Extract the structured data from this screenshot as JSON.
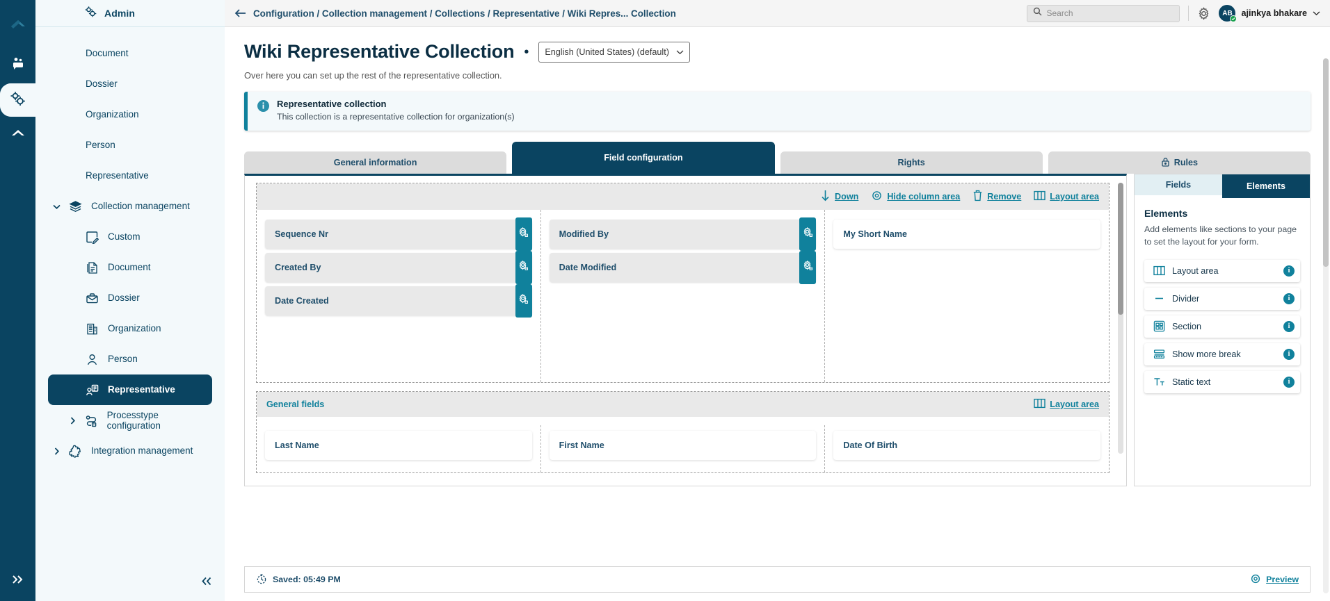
{
  "rail": {
    "logo_icon": "cloud-logo-icon",
    "items": [
      {
        "icon": "people-group-icon",
        "active": false
      },
      {
        "icon": "gears-config-icon",
        "active": true
      },
      {
        "icon": "cloud-arrow-icon",
        "active": false
      }
    ],
    "expand_icon": "chevron-double-right-icon"
  },
  "sidebar": {
    "header": {
      "icon": "gears-icon",
      "title": "Admin"
    },
    "items": [
      {
        "label": "Document",
        "level": "plain",
        "icon": null,
        "chevron": null,
        "active": false
      },
      {
        "label": "Dossier",
        "level": "plain",
        "icon": null,
        "chevron": null,
        "active": false
      },
      {
        "label": "Organization",
        "level": "plain",
        "icon": null,
        "chevron": null,
        "active": false
      },
      {
        "label": "Person",
        "level": "plain",
        "icon": null,
        "chevron": null,
        "active": false
      },
      {
        "label": "Representative",
        "level": "plain",
        "icon": null,
        "chevron": null,
        "active": false
      },
      {
        "label": "Collection management",
        "level": "lvl0",
        "icon": "layers-icon",
        "chevron": "down",
        "active": false
      },
      {
        "label": "Custom",
        "level": "lvl1",
        "icon": "note-edit-icon",
        "chevron": null,
        "active": false
      },
      {
        "label": "Document",
        "level": "lvl1",
        "icon": "document-icon",
        "chevron": null,
        "active": false
      },
      {
        "label": "Dossier",
        "level": "lvl1",
        "icon": "briefcase-icon",
        "chevron": null,
        "active": false
      },
      {
        "label": "Organization",
        "level": "lvl1",
        "icon": "building-icon",
        "chevron": null,
        "active": false
      },
      {
        "label": "Person",
        "level": "lvl1",
        "icon": "person-icon",
        "chevron": null,
        "active": false
      },
      {
        "label": "Representative",
        "level": "lvl1",
        "icon": "representative-icon",
        "chevron": null,
        "active": true
      },
      {
        "label": "Processtype configuration",
        "level": "lvl1",
        "icon": "processtype-icon",
        "chevron": "right",
        "active": false
      },
      {
        "label": "Integration management",
        "level": "lvl0",
        "icon": "puzzle-icon",
        "chevron": "right",
        "active": false
      }
    ],
    "collapse_icon": "chevron-double-left-icon"
  },
  "topbar": {
    "back_icon": "arrow-left-icon",
    "breadcrumb": "Configuration / Collection management / Collections / Representative / Wiki Repres... Collection",
    "search": {
      "placeholder": "Search",
      "value": "",
      "icon": "search-icon"
    },
    "settings_icon": "gear-icon",
    "user": {
      "initials": "AB",
      "name": "ajinkya bhakare",
      "status": "online",
      "chevron": "chevron-down-icon"
    }
  },
  "page": {
    "title": "Wiki Representative Collection",
    "title_dot": "•",
    "language": {
      "value": "English (United States) (default)",
      "chevron": "chevron-down-icon"
    },
    "subtitle": "Over here you can set up the rest of the representative collection.",
    "notice": {
      "icon": "info-icon",
      "title": "Representative collection",
      "text": "This collection is a representative collection for organization(s)"
    },
    "tabs": [
      {
        "label": "General information",
        "active": false,
        "icon": null
      },
      {
        "label": "Field configuration",
        "active": true,
        "icon": null
      },
      {
        "label": "Rights",
        "active": false,
        "icon": null
      },
      {
        "label": "Rules",
        "active": false,
        "icon": "lock-icon"
      }
    ]
  },
  "canvas": {
    "toolbar": [
      {
        "label": "Down",
        "icon": "arrow-down-icon"
      },
      {
        "label": "Hide column area",
        "icon": "eye-icon"
      },
      {
        "label": "Remove",
        "icon": "trash-icon"
      },
      {
        "label": "Layout area",
        "icon": "columns-icon"
      }
    ],
    "columns": [
      {
        "fields": [
          {
            "label": "Sequence Nr",
            "style": "gray",
            "gear_icon": "gear-settings-icon"
          },
          {
            "label": "Created By",
            "style": "gray",
            "gear_icon": "gear-settings-icon"
          },
          {
            "label": "Date Created",
            "style": "gray",
            "gear_icon": "gear-settings-icon"
          }
        ]
      },
      {
        "fields": [
          {
            "label": "Modified By",
            "style": "gray",
            "gear_icon": "gear-settings-icon"
          },
          {
            "label": "Date Modified",
            "style": "gray",
            "gear_icon": "gear-settings-icon"
          }
        ]
      },
      {
        "fields": [
          {
            "label": "My Short Name",
            "style": "white",
            "gear_icon": null
          }
        ]
      }
    ],
    "section": {
      "title": "General fields",
      "layout_action": {
        "label": "Layout area",
        "icon": "columns-icon"
      },
      "columns": [
        {
          "fields": [
            {
              "label": "Last Name",
              "style": "white"
            }
          ]
        },
        {
          "fields": [
            {
              "label": "First Name",
              "style": "white"
            }
          ]
        },
        {
          "fields": [
            {
              "label": "Date Of Birth",
              "style": "white"
            }
          ]
        }
      ]
    }
  },
  "right_panel": {
    "tabs": [
      {
        "label": "Fields",
        "active": false
      },
      {
        "label": "Elements",
        "active": true
      }
    ],
    "heading": "Elements",
    "description": "Add elements like sections to your page to set the layout for your form.",
    "items": [
      {
        "label": "Layout area",
        "icon": "columns-icon",
        "info": "i"
      },
      {
        "label": "Divider",
        "icon": "minus-icon",
        "info": "i"
      },
      {
        "label": "Section",
        "icon": "section-grid-icon",
        "info": "i"
      },
      {
        "label": "Show more break",
        "icon": "show-more-icon",
        "info": "i"
      },
      {
        "label": "Static text",
        "icon": "text-format-icon",
        "info": "i"
      }
    ]
  },
  "bottombar": {
    "saved_icon": "clock-icon",
    "saved_label": "Saved: 05:49 PM",
    "preview": {
      "label": "Preview",
      "icon": "eye-icon"
    }
  },
  "colors": {
    "brand_dark": "#0a4461",
    "accent_teal": "#10819c",
    "panel_bg": "#f3f9fb",
    "field_gray": "#e9e9e9"
  }
}
